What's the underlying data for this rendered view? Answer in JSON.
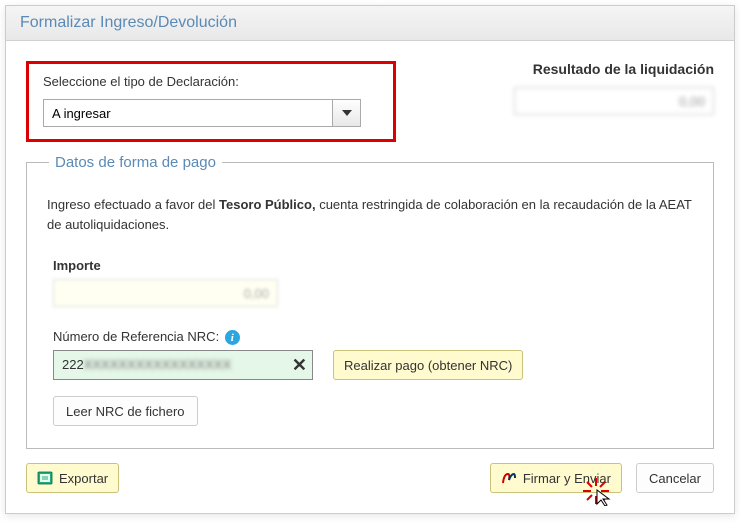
{
  "header": {
    "title": "Formalizar Ingreso/Devolución"
  },
  "select": {
    "label": "Seleccione el tipo de Declaración:",
    "value": "A ingresar"
  },
  "result": {
    "label": "Resultado de la liquidación",
    "value": "0,00"
  },
  "datos": {
    "legend": "Datos de forma de pago",
    "intro_a": "Ingreso efectuado a favor del ",
    "intro_strong": "Tesoro Público,",
    "intro_b": " cuenta restringida de colaboración en la recaudación de la AEAT de autoliquidaciones.",
    "importe_label": "Importe",
    "importe_value": "0,00",
    "nrc_label": "Número de Referencia  NRC:",
    "nrc_value_prefix": "222",
    "nrc_value_blur": "XXXXXXXXXXXXXXXXX",
    "nrc_pago": "Realizar pago (obtener NRC)",
    "leer_nrc": "Leer NRC de fichero"
  },
  "footer": {
    "exportar": "Exportar",
    "firmar": "Firmar y Enviar",
    "cancelar": "Cancelar"
  }
}
